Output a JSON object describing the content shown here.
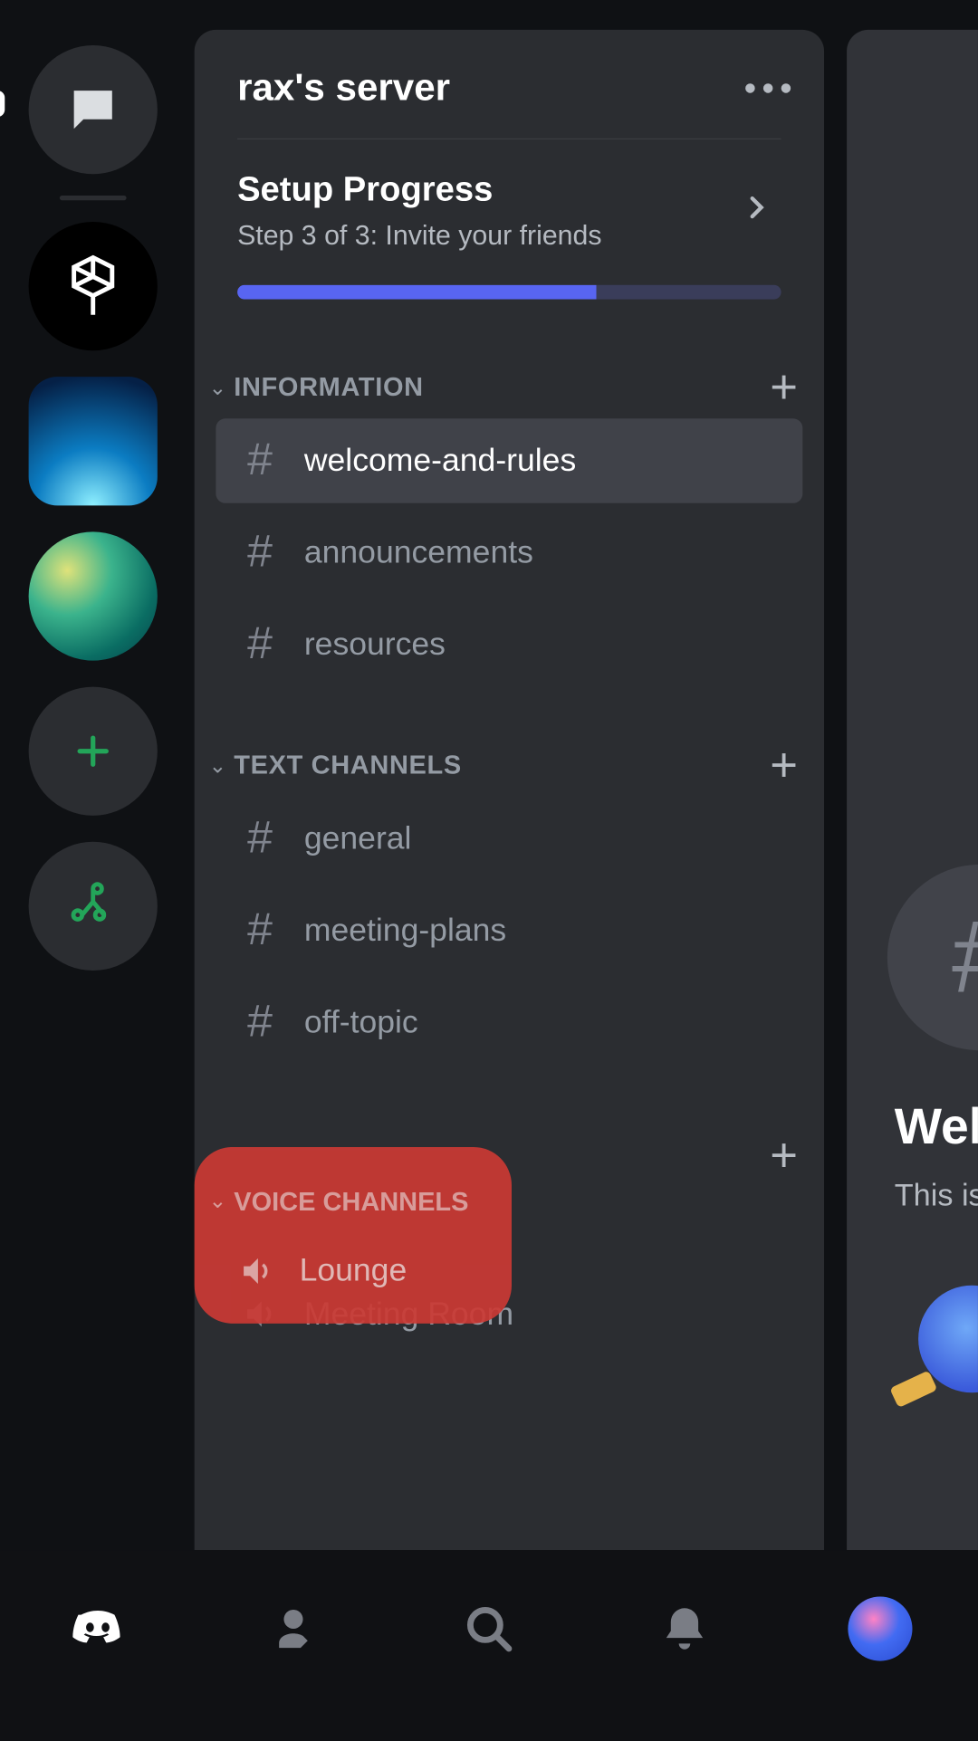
{
  "server": {
    "title": "rax's server"
  },
  "setup": {
    "title": "Setup Progress",
    "subtitle": "Step 3 of 3: Invite your friends",
    "progress_percent": 66
  },
  "categories": [
    {
      "name": "INFORMATION",
      "channels": [
        {
          "name": "welcome-and-rules",
          "type": "text",
          "active": true
        },
        {
          "name": "announcements",
          "type": "text",
          "active": false
        },
        {
          "name": "resources",
          "type": "text",
          "active": false
        }
      ]
    },
    {
      "name": "TEXT CHANNELS",
      "channels": [
        {
          "name": "general",
          "type": "text",
          "active": false
        },
        {
          "name": "meeting-plans",
          "type": "text",
          "active": false
        },
        {
          "name": "off-topic",
          "type": "text",
          "active": false
        }
      ]
    },
    {
      "name": "VOICE CHANNELS",
      "channels": [
        {
          "name": "Lounge",
          "type": "voice",
          "active": false
        },
        {
          "name": "Meeting Room",
          "type": "voice",
          "active": false
        }
      ]
    }
  ],
  "highlight": {
    "category": "VOICE CHANNELS",
    "channel": "Lounge"
  },
  "content_peek": {
    "title": "Wel",
    "subtitle": "This is"
  },
  "colors": {
    "brand": "#5865f2",
    "highlight": "#cb3a34",
    "add_green": "#23a559"
  }
}
